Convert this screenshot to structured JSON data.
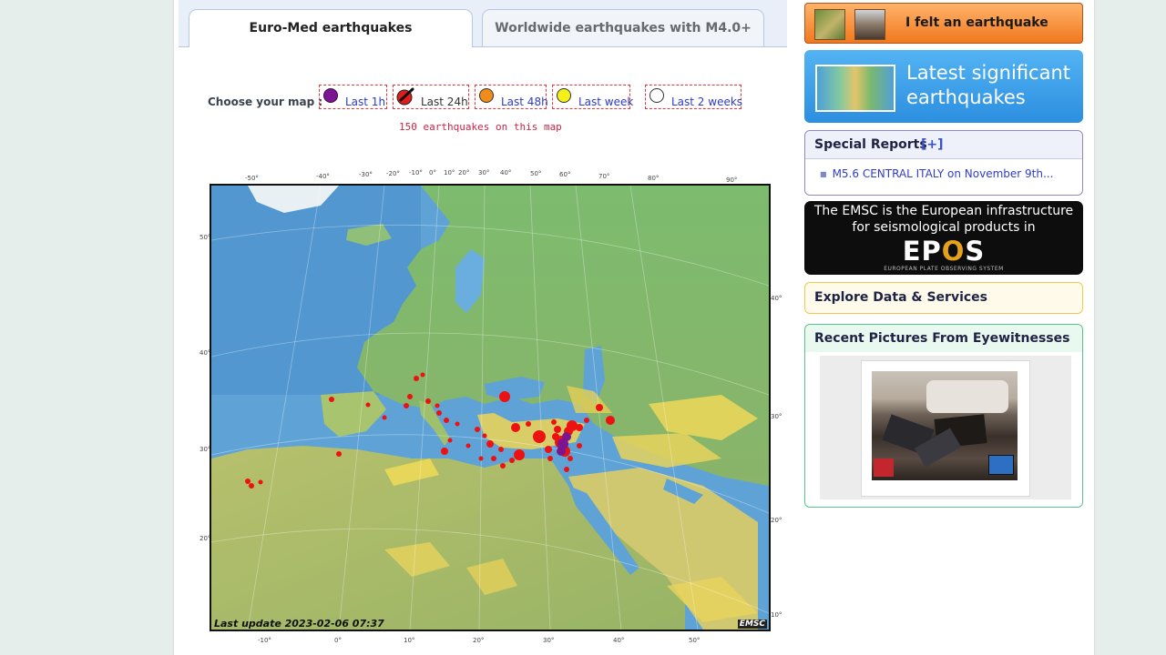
{
  "tabs": [
    {
      "label": "Euro-Med earthquakes",
      "active": true
    },
    {
      "label": "Worldwide earthquakes with M4.0+",
      "active": false
    }
  ],
  "chooser": {
    "label": "Choose your map :",
    "options": [
      {
        "label": "Last 1h",
        "color": "#7b1590"
      },
      {
        "label": "Last 24h",
        "color": "#e31b1b",
        "selected": true
      },
      {
        "label": "Last 48h",
        "color": "#f08c1a"
      },
      {
        "label": "Last week",
        "color": "#f5ef1a"
      },
      {
        "label": "Last 2 weeks",
        "color": "#ffffff"
      }
    ],
    "count_text": "150 earthquakes on this map"
  },
  "map": {
    "last_update": "Last update 2023-02-06 07:37",
    "logo": "EMSC",
    "colors": {
      "sea": "#5fa3d6",
      "land_low": "#6fae68",
      "land_high": "#e9d65f",
      "quake": "#ee1111",
      "recent": "#7b1590"
    },
    "lat_labels_left": [
      "50°",
      "40°",
      "30°",
      "20°"
    ],
    "lat_labels_right": [
      "40°",
      "30°",
      "20°",
      "10°"
    ],
    "lon_labels_bottom": [
      "-10°",
      "0°",
      "10°",
      "20°",
      "30°",
      "40°",
      "50°"
    ],
    "lon_labels_top": [
      "-50°",
      "-40°",
      "-30°",
      "-20°",
      "-10°",
      "0°",
      "10°",
      "20°",
      "30°",
      "40°",
      "50°",
      "60°",
      "70°",
      "80°",
      "90°"
    ]
  },
  "sidebar": {
    "felt_button": "I felt an earthquake",
    "latest_button": "Latest significant earthquakes",
    "special_reports": {
      "title": "Special Reports",
      "plus": "[+]",
      "item": "M5.6 CENTRAL ITALY on November 9th..."
    },
    "epos": {
      "line1": "The EMSC is the European infrastructure",
      "line2": "for seismological products in",
      "logo_a": "EP",
      "logo_b": "O",
      "logo_c": "S",
      "sub": "EUROPEAN PLATE OBSERVING SYSTEM"
    },
    "explore": "Explore Data & Services",
    "recent_pictures": "Recent Pictures From Eyewitnesses"
  }
}
